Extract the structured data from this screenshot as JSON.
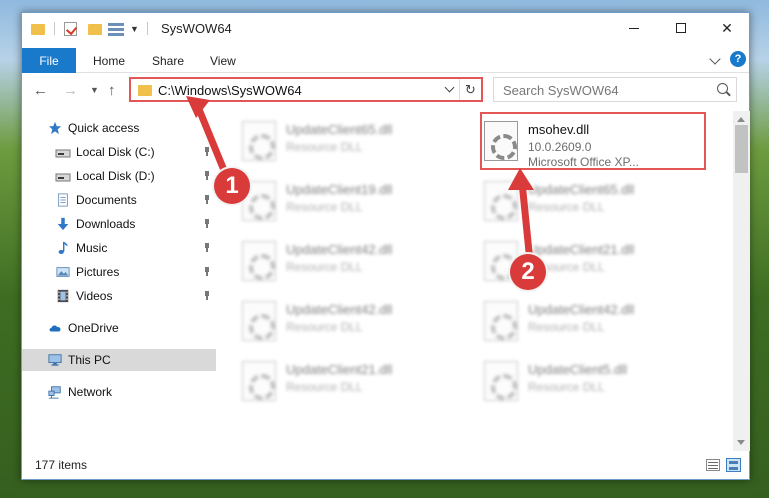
{
  "window": {
    "title": "SysWOW64",
    "controls": {
      "minimize": "minimize",
      "maximize": "maximize",
      "close": "✕"
    }
  },
  "ribbon": {
    "tabs": [
      "File",
      "Home",
      "Share",
      "View"
    ],
    "help": "?"
  },
  "navigation": {
    "address": "C:\\Windows\\SysWOW64",
    "search_placeholder": "Search SysWOW64"
  },
  "sidebar": {
    "items": [
      {
        "label": "Quick access",
        "icon": "star-icon"
      },
      {
        "label": "Local Disk (C:)",
        "icon": "drive-icon",
        "pinned": true
      },
      {
        "label": "Local Disk (D:)",
        "icon": "drive-icon",
        "pinned": true
      },
      {
        "label": "Documents",
        "icon": "documents-icon",
        "pinned": true
      },
      {
        "label": "Downloads",
        "icon": "download-arrow-icon",
        "pinned": true
      },
      {
        "label": "Music",
        "icon": "music-note-icon",
        "pinned": true
      },
      {
        "label": "Pictures",
        "icon": "pictures-icon",
        "pinned": true
      },
      {
        "label": "Videos",
        "icon": "film-icon",
        "pinned": true
      },
      {
        "label": "OneDrive",
        "icon": "cloud-icon"
      },
      {
        "label": "This PC",
        "icon": "computer-icon",
        "selected": true
      },
      {
        "label": "Network",
        "icon": "network-icon"
      }
    ]
  },
  "files": {
    "left_column": [
      {
        "name": "UpdateClient65.dll",
        "type": "Resource DLL"
      },
      {
        "name": "UpdateClient19.dll",
        "type": "Resource DLL"
      },
      {
        "name": "UpdateClient42.dll",
        "type": "Resource DLL"
      },
      {
        "name": "UpdateClient42.dll",
        "type": "Resource DLL"
      },
      {
        "name": "UpdateClient21.dll",
        "type": "Resource DLL"
      }
    ],
    "right_column": [
      {
        "name": "msohev.dll",
        "version": "10.0.2609.0",
        "company": "Microsoft Office XP..."
      },
      {
        "name": "UpdateClient65.dll",
        "type": "Resource DLL"
      },
      {
        "name": "UpdateClient21.dll",
        "type": "Resource DLL"
      },
      {
        "name": "UpdateClient42.dll",
        "type": "Resource DLL"
      },
      {
        "name": "UpdateClient5.dll",
        "type": "Resource DLL"
      }
    ]
  },
  "status": {
    "count": "177 items"
  },
  "annotations": {
    "step1": "1",
    "step2": "2",
    "accent": "#d93a3a"
  }
}
